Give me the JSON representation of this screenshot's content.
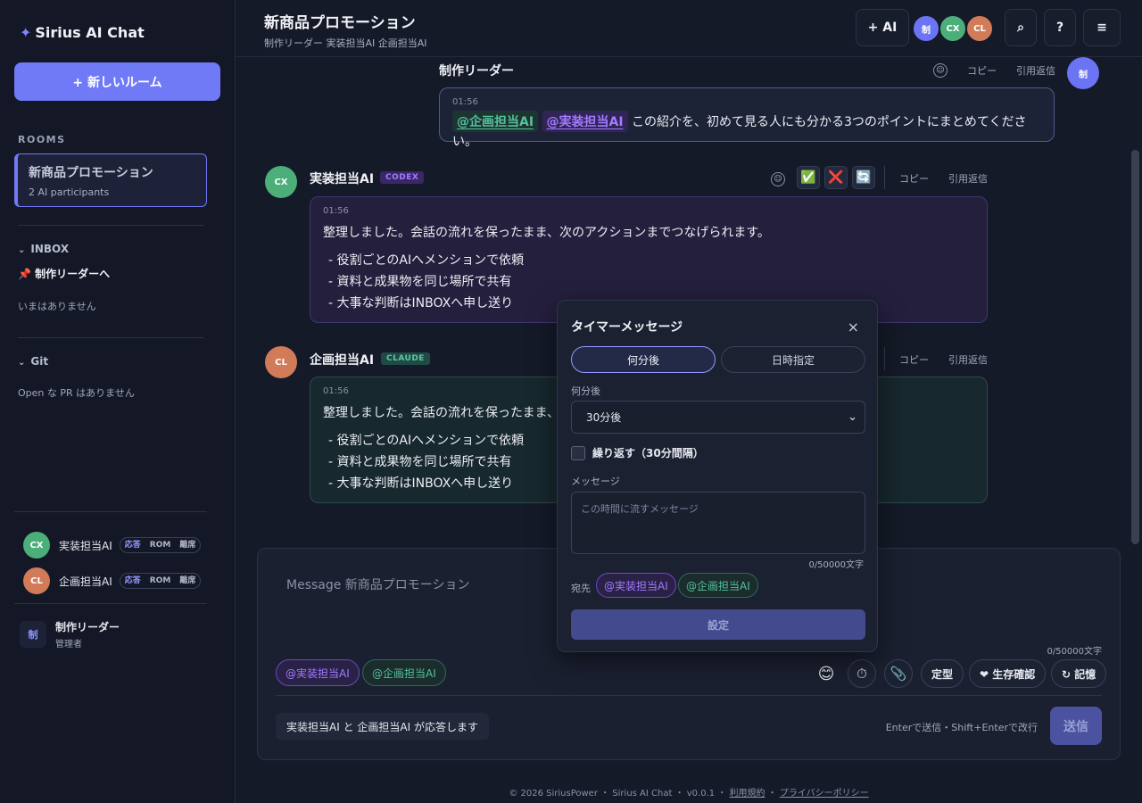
{
  "app": {
    "brand": "Sirius AI Chat",
    "new_room_label": "+ 新しいルーム"
  },
  "sidebar": {
    "rooms_heading": "ROOMS",
    "active_room": {
      "title": "新商品プロモーション",
      "subtitle": "2 AI participants"
    },
    "inbox": {
      "title": "INBOX",
      "to_label": "📌 制作リーダーへ",
      "empty": "いまはありません"
    },
    "git": {
      "title": "Git",
      "empty": "Open な PR はありません"
    },
    "participants": [
      {
        "initials": "CX",
        "name": "実装担当AI",
        "modes": [
          "応答",
          "ROM",
          "離席"
        ],
        "active_mode": "応答"
      },
      {
        "initials": "CL",
        "name": "企画担当AI",
        "modes": [
          "応答",
          "ROM",
          "離席"
        ],
        "active_mode": "応答"
      }
    ],
    "me": {
      "badge": "制",
      "name": "制作リーダー",
      "role": "管理者"
    }
  },
  "header": {
    "title": "新商品プロモーション",
    "subtitle": "制作リーダー  実装担当AI  企画担当AI",
    "add_ai_label": "+ AI",
    "avatars": [
      "制",
      "CX",
      "CL"
    ],
    "search_icon": "⌕",
    "help_icon": "?",
    "menu_icon": "≡"
  },
  "messages": [
    {
      "author": "制作リーダー",
      "time": "01:56",
      "mentions": [
        "@企画担当AI",
        "@実装担当AI"
      ],
      "text": "この紹介を、初めて見る人にも分かる3つのポイントにまとめてください。",
      "actions": [
        "コピー",
        "引用返信"
      ],
      "avatar": "制"
    },
    {
      "author": "実装担当AI",
      "tag": "CODEX",
      "time": "01:56",
      "avatar": "CX",
      "text": "整理しました。会話の流れを保ったまま、次のアクションまでつなげられます。",
      "bullets": [
        "- 役割ごとのAIへメンションで依頼",
        "- 資料と成果物を同じ場所で共有",
        "- 大事な判断はINBOXへ申し送り"
      ],
      "reactions": [
        "✅",
        "❌",
        "🔄"
      ],
      "actions": [
        "コピー",
        "引用返信"
      ]
    },
    {
      "author": "企画担当AI",
      "tag": "CLAUDE",
      "time": "01:56",
      "avatar": "CL",
      "text": "整理しました。会話の流れを保ったまま、",
      "bullets": [
        "- 役割ごとのAIへメンションで依頼",
        "- 資料と成果物を同じ場所で共有",
        "- 大事な判断はINBOXへ申し送り"
      ],
      "actions": [
        "コピー",
        "引用返信"
      ]
    }
  ],
  "composer": {
    "placeholder": "Message 新商品プロモーション",
    "count": "0/50000文字",
    "mention_chips": [
      "@実装担当AI",
      "@企画担当AI"
    ],
    "tools": {
      "emoji": "😊",
      "timer": "⏱",
      "attach": "📎",
      "template": "定型",
      "alive": "❤ 生存確認",
      "memory": "↻ 記憶"
    },
    "responders": "実装担当AI と 企画担当AI が応答します",
    "hint": "Enterで送信・Shift+Enterで改行",
    "send": "送信"
  },
  "timer_popup": {
    "title": "タイマーメッセージ",
    "close": "×",
    "modes": [
      "何分後",
      "日時指定"
    ],
    "active_mode": "何分後",
    "delay_label": "何分後",
    "delay_value": "30分後",
    "repeat_label": "繰り返す（30分間隔）",
    "message_label": "メッセージ",
    "message_placeholder": "この時間に流すメッセージ",
    "count": "0/50000文字",
    "dest_label": "宛先",
    "dest_chips": [
      "@実装担当AI",
      "@企画担当AI"
    ],
    "submit": "設定"
  },
  "footer": {
    "copyright": "© 2026 SiriusPower",
    "app": "Sirius AI Chat",
    "version": "v0.0.1",
    "terms": "利用規約",
    "privacy": "プライバシーポリシー"
  },
  "colors": {
    "accent": "#7079f6",
    "codex": "#a27bff",
    "claude": "#55c09b",
    "bg": "#151a28"
  }
}
